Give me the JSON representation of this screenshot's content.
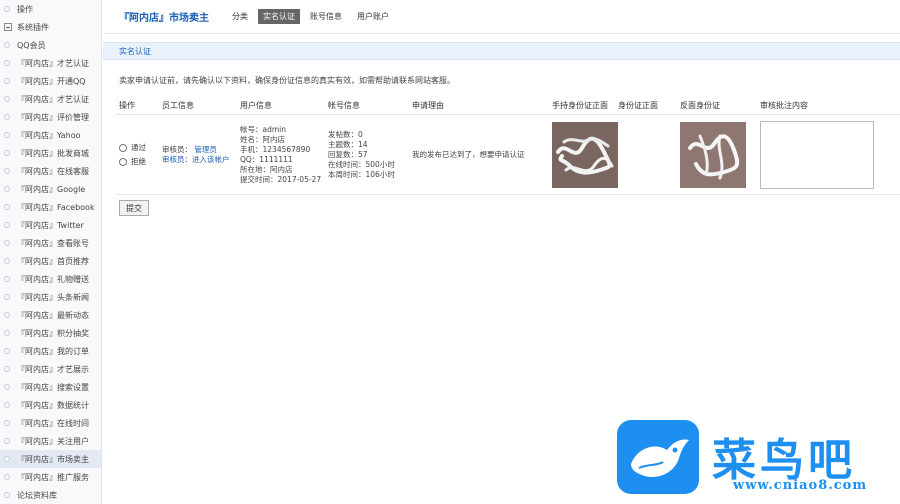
{
  "header": {
    "site_title": "『阿内店』市场卖主",
    "tabs": [
      "分类",
      "实名认证",
      "账号信息",
      "用户账户"
    ],
    "active_tab": 1
  },
  "sidebar": {
    "items": [
      {
        "label": "操作",
        "type": "item"
      },
      {
        "label": "系统插件",
        "type": "group"
      },
      {
        "label": "QQ会员",
        "type": "item"
      },
      {
        "label": "『阿内店』才艺认证",
        "type": "item"
      },
      {
        "label": "『阿内店』开通QQ",
        "type": "item"
      },
      {
        "label": "『阿内店』才艺认证",
        "type": "item"
      },
      {
        "label": "『阿内店』评价管理",
        "type": "item"
      },
      {
        "label": "『阿内店』Yahoo",
        "type": "item"
      },
      {
        "label": "『阿内店』批发商城",
        "type": "item"
      },
      {
        "label": "『阿内店』在线客服",
        "type": "item"
      },
      {
        "label": "『阿内店』Google",
        "type": "item"
      },
      {
        "label": "『阿内店』Facebook",
        "type": "item"
      },
      {
        "label": "『阿内店』Twitter",
        "type": "item"
      },
      {
        "label": "『阿内店』查看账号",
        "type": "item"
      },
      {
        "label": "『阿内店』首页推荐",
        "type": "item"
      },
      {
        "label": "『阿内店』礼物赠送",
        "type": "item"
      },
      {
        "label": "『阿内店』头条新闻",
        "type": "item"
      },
      {
        "label": "『阿内店』最新动态",
        "type": "item"
      },
      {
        "label": "『阿内店』积分抽奖",
        "type": "item"
      },
      {
        "label": "『阿内店』我的订单",
        "type": "item"
      },
      {
        "label": "『阿内店』才艺展示",
        "type": "item"
      },
      {
        "label": "『阿内店』搜索设置",
        "type": "item"
      },
      {
        "label": "『阿内店』数据统计",
        "type": "item"
      },
      {
        "label": "『阿内店』在线时间",
        "type": "item"
      },
      {
        "label": "『阿内店』关注用户",
        "type": "item"
      },
      {
        "label": "『阿内店』市场卖主",
        "type": "item",
        "active": true
      },
      {
        "label": "『阿内店』推广服务",
        "type": "item"
      },
      {
        "label": "论坛资料库",
        "type": "item"
      }
    ]
  },
  "section": {
    "title": "实名认证",
    "notice": "卖家申请认证前，请先确认以下资料，确保身份证信息的真实有效，如需帮助请联系网站客服。"
  },
  "table": {
    "headers": [
      "操作",
      "员工信息",
      "用户信息",
      "帐号信息",
      "申请理由",
      "手持身份证正面",
      "身份证正面",
      "反面身份证",
      "审核批注内容"
    ],
    "row": {
      "op_approve": "通过",
      "op_reject": "拒绝",
      "worker_lines": [
        "审核员：",
        "审核员：进入该帐户"
      ],
      "worker_link": "管理员",
      "user_lines": [
        "帐号：admin",
        "姓名：阿内店",
        "手机：1234567890",
        "QQ：1111111",
        "所在地：阿内店",
        "提交时间：2017-05-27"
      ],
      "account_lines": [
        "发帖数：0",
        "主题数：14",
        "回复数：57",
        "在线时间：500小时",
        "本周时间：106小时"
      ],
      "reason": "我的发布已达到了，想要申请认证",
      "note_value": ""
    }
  },
  "submit_label": "提交",
  "watermark": {
    "text": "菜鸟吧",
    "url": "www.cniao8.com"
  }
}
